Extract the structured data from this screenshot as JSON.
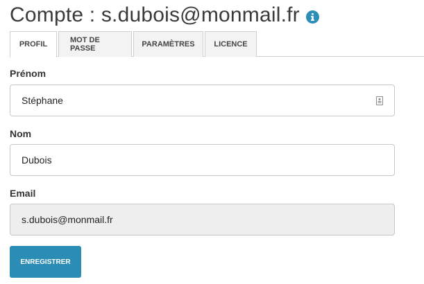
{
  "header": {
    "title": "Compte  :  s.dubois@monmail.fr",
    "info_icon": "info-icon"
  },
  "tabs": [
    {
      "label": "PROFIL",
      "active": true
    },
    {
      "label": "MOT DE PASSE",
      "active": false
    },
    {
      "label": "PARAMÈTRES",
      "active": false
    },
    {
      "label": "LICENCE",
      "active": false
    }
  ],
  "form": {
    "prenom": {
      "label": "Prénom",
      "value": "Stéphane",
      "icon": "contact-card-icon"
    },
    "nom": {
      "label": "Nom",
      "value": "Dubois"
    },
    "email": {
      "label": "Email",
      "value": "s.dubois@monmail.fr",
      "readonly": true
    }
  },
  "actions": {
    "save_label": "ENREGISTRER"
  },
  "colors": {
    "accent": "#2b8db5",
    "readonly_bg": "#eeeeee"
  }
}
